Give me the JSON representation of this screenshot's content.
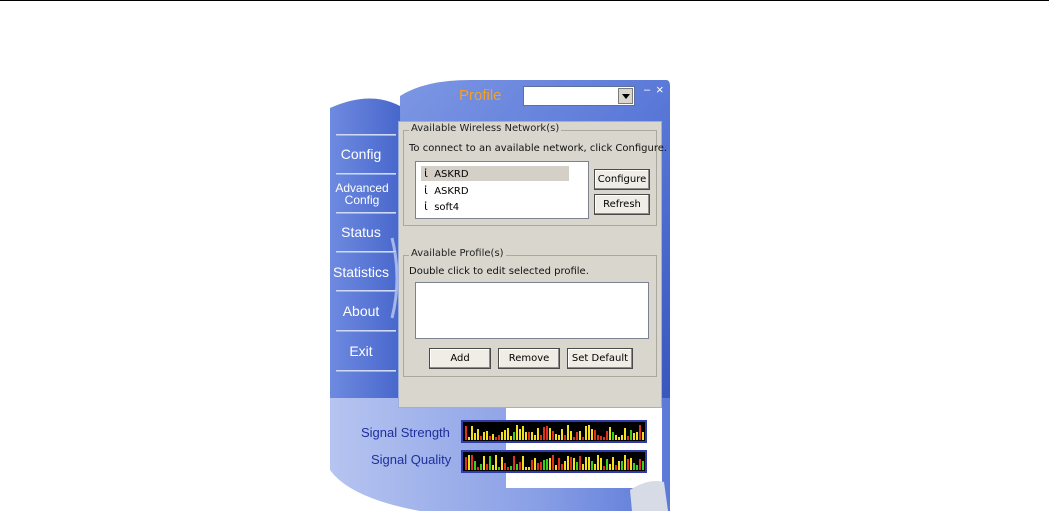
{
  "app": {
    "title": "Profile",
    "profile_select_value": "",
    "minimize_glyph": "–",
    "close_glyph": "×"
  },
  "nav": {
    "items": [
      {
        "label": "Config"
      },
      {
        "label": "Advanced Config"
      },
      {
        "label": "Status"
      },
      {
        "label": "Statistics"
      },
      {
        "label": "About"
      },
      {
        "label": "Exit"
      }
    ]
  },
  "networks": {
    "group_title": "Available Wireless Network(s)",
    "hint": "To connect to an available network, click Configure.",
    "items": [
      {
        "ssid": "ASKRD",
        "selected": true,
        "icon": "person-icon"
      },
      {
        "ssid": "ASKRD",
        "selected": false,
        "icon": "person-icon"
      },
      {
        "ssid": "soft4",
        "selected": false,
        "icon": "person-icon"
      }
    ],
    "configure_label": "Configure",
    "refresh_label": "Refresh"
  },
  "profiles": {
    "group_title": "Available Profile(s)",
    "hint": "Double click to edit selected profile.",
    "items": [],
    "add_label": "Add",
    "remove_label": "Remove",
    "set_default_label": "Set Default"
  },
  "meters": {
    "signal_strength_label": "Signal Strength",
    "signal_quality_label": "Signal Quality",
    "colors": {
      "yellow": "#f0e020",
      "green": "#37d11c",
      "red": "#e0321c"
    }
  }
}
